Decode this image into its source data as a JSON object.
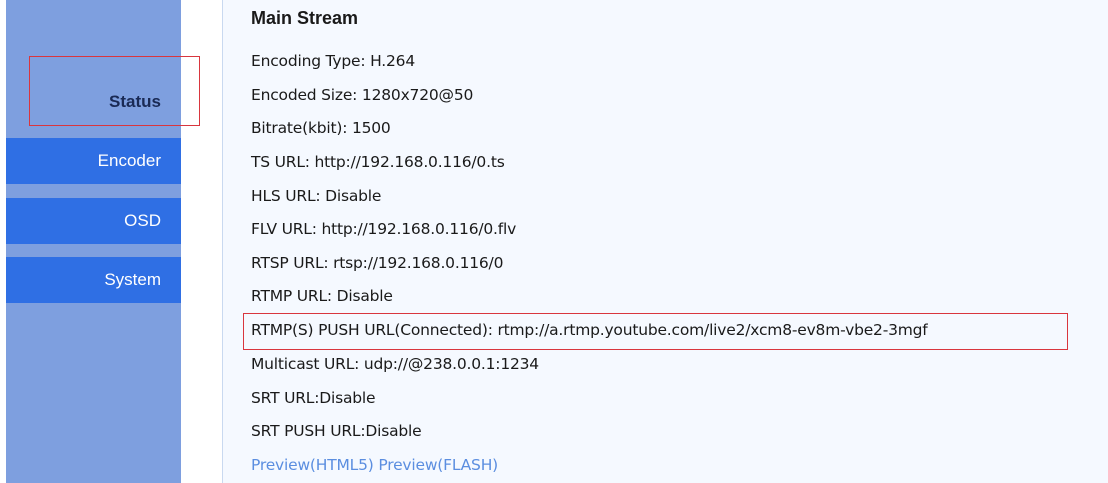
{
  "sidebar": {
    "items": [
      {
        "label": "Status"
      },
      {
        "label": "Encoder"
      },
      {
        "label": "OSD"
      },
      {
        "label": "System"
      }
    ]
  },
  "main": {
    "heading": "Main Stream",
    "lines": [
      "Encoding Type: H.264",
      "Encoded Size: 1280x720@50",
      "Bitrate(kbit): 1500",
      "TS URL: http://192.168.0.116/0.ts",
      "HLS URL: Disable",
      "FLV URL: http://192.168.0.116/0.flv",
      "RTSP URL: rtsp://192.168.0.116/0",
      "RTMP URL: Disable",
      "RTMP(S) PUSH URL(Connected): rtmp://a.rtmp.youtube.com/live2/xcm8-ev8m-vbe2-3mgf",
      "Multicast URL: udp://@238.0.0.1:1234",
      "SRT URL:Disable",
      "SRT PUSH URL:Disable"
    ],
    "preview_html5": "Preview(HTML5)",
    "preview_flash": "Preview(FLASH)"
  },
  "colors": {
    "sidebar_bg": "#7e9fdf",
    "nav_active_blue": "#2f6fe4",
    "content_bg": "#f5f9ff",
    "highlight_red": "#d9363e",
    "link_blue": "#5b8ee0"
  }
}
